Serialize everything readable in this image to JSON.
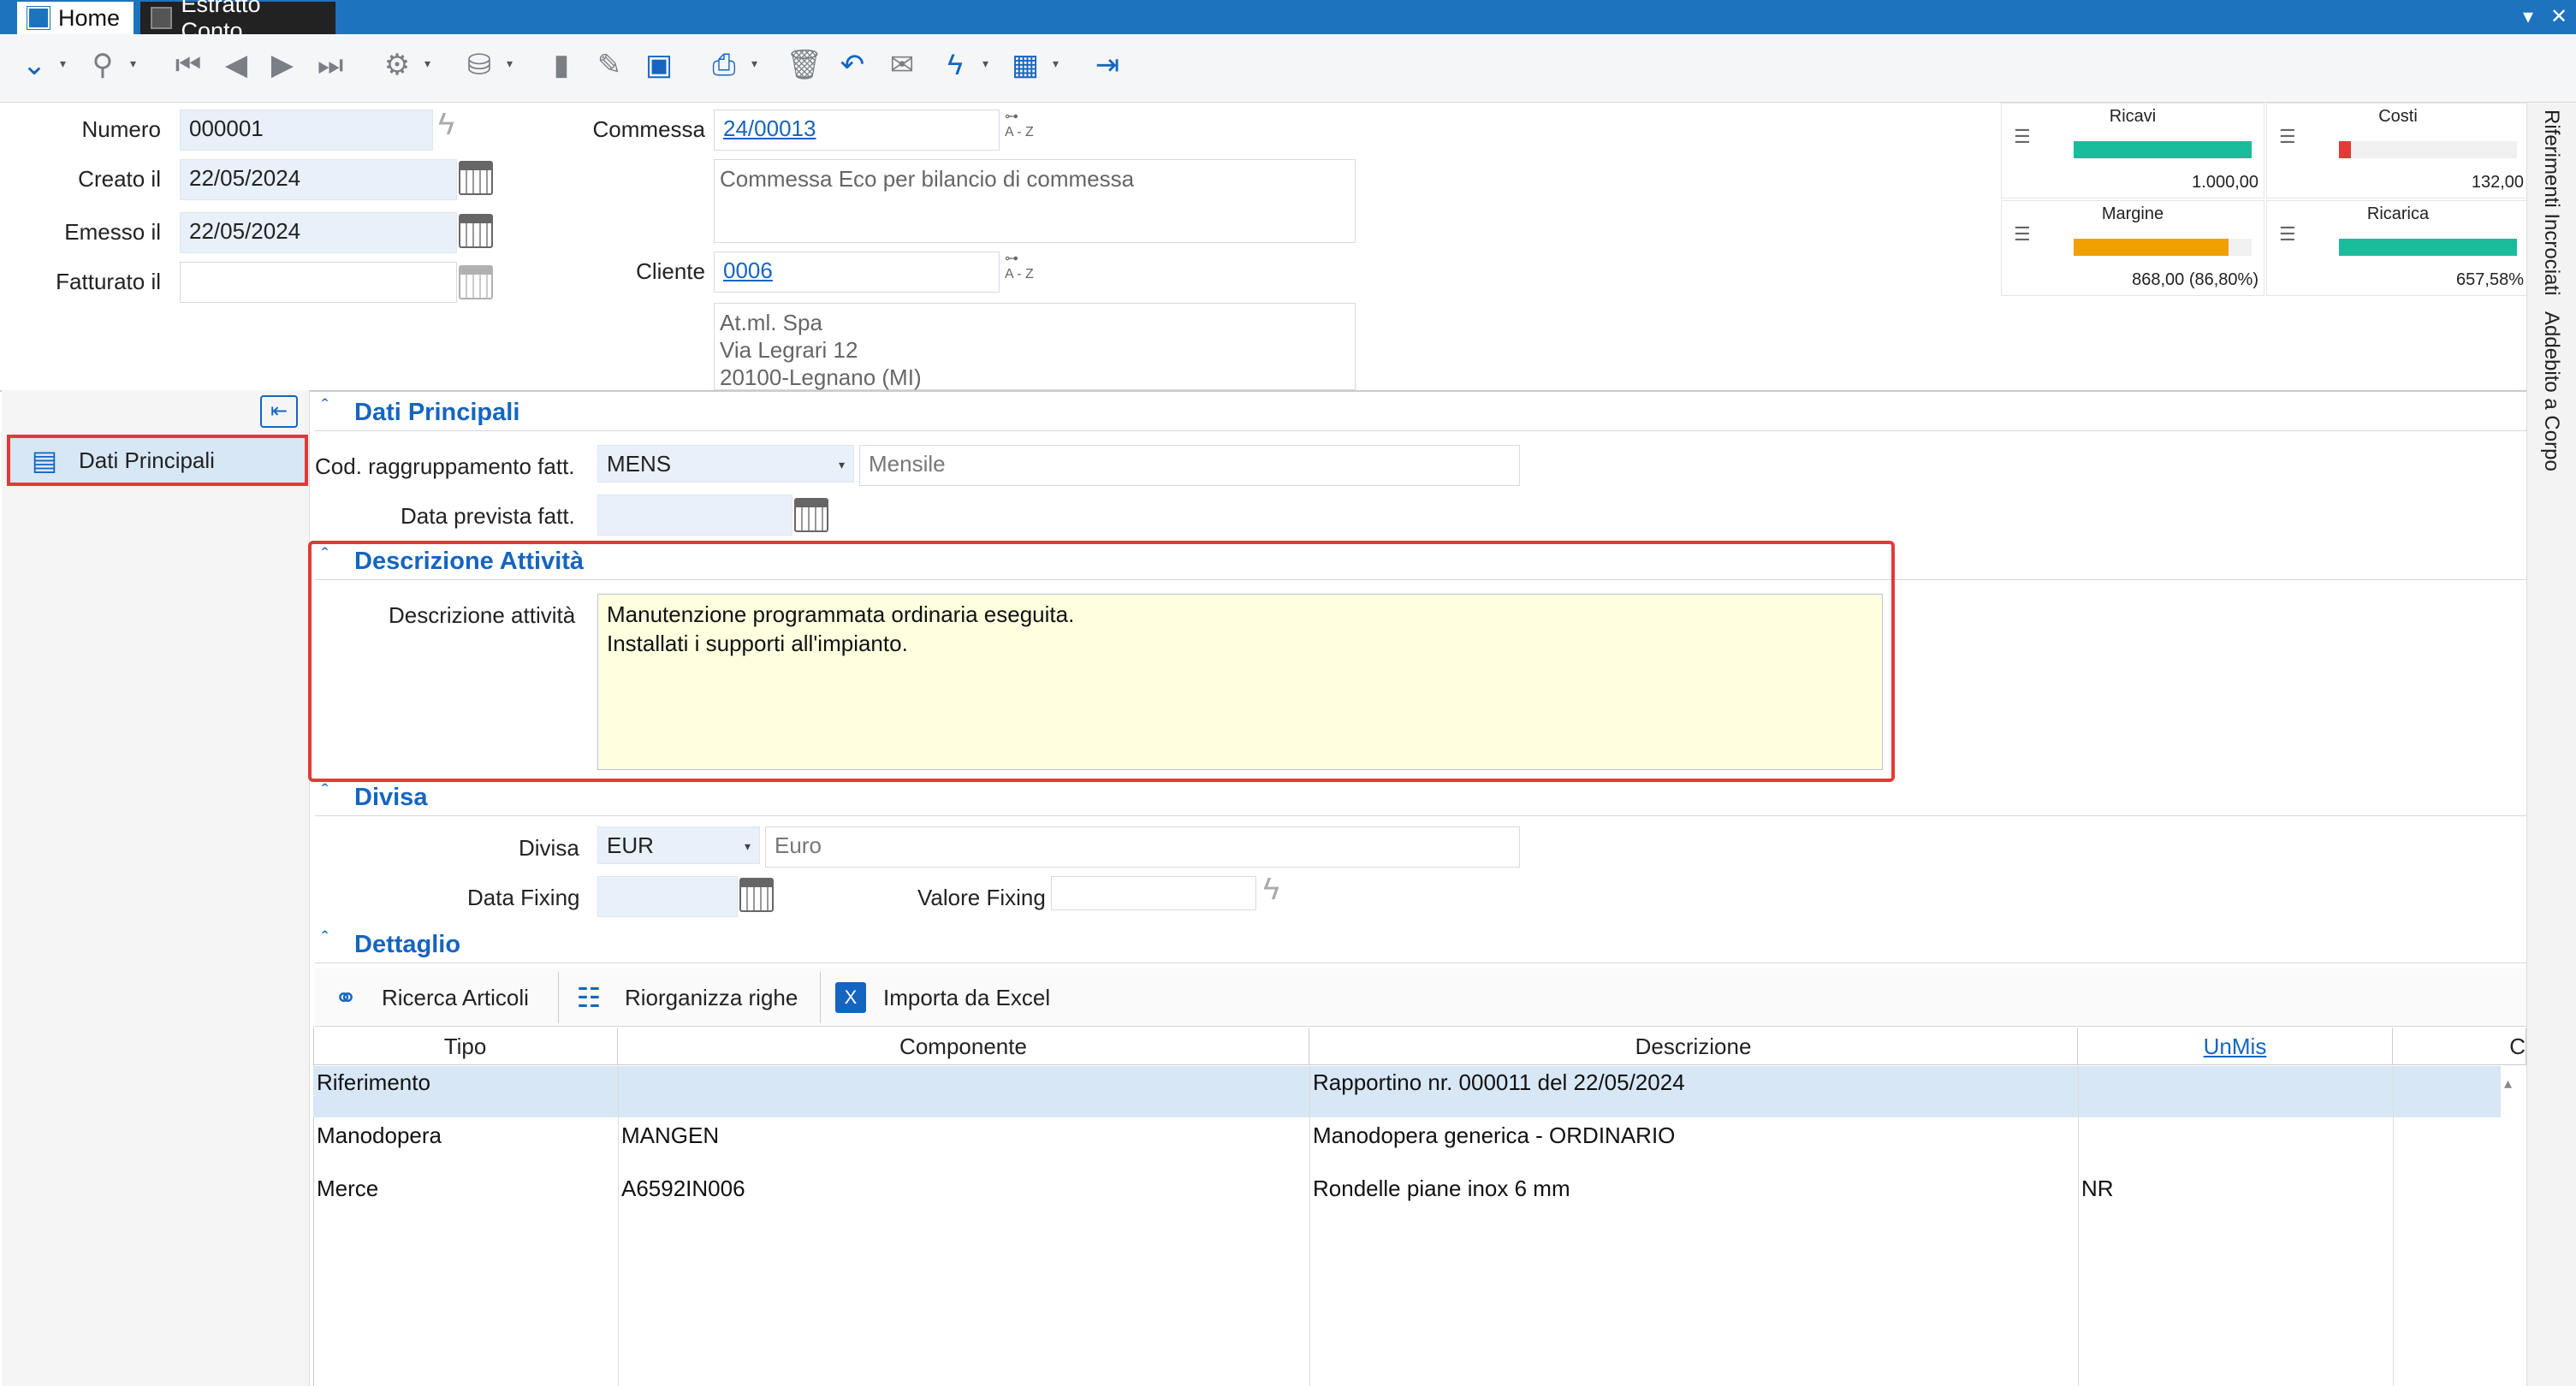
{
  "tabs": {
    "home": "Home",
    "estratto": "Estratto Conto"
  },
  "window_buttons": {
    "menu": "▾",
    "close": "✕"
  },
  "header": {
    "numero_label": "Numero",
    "numero_value": "000001",
    "creato_label": "Creato il",
    "creato_value": "22/05/2024",
    "emesso_label": "Emesso il",
    "emesso_value": "22/05/2024",
    "fatturato_label": "Fatturato il",
    "fatturato_value": "",
    "commessa_label": "Commessa",
    "commessa_value": "24/00013",
    "commessa_desc": "Commessa Eco per bilancio di commessa",
    "cliente_label": "Cliente",
    "cliente_value": "0006",
    "cliente_address": "At.ml. Spa\nVia Legrari 12\n20100-Legnano (MI)",
    "az_label": "A - Z"
  },
  "kpi": {
    "ricavi": {
      "title": "Ricavi",
      "value": "1.000,00",
      "fill": 1.0,
      "color": "#1abc9c"
    },
    "costi": {
      "title": "Costi",
      "value": "132,00",
      "fill": 0.13,
      "color": "#e53935"
    },
    "margine": {
      "title": "Margine",
      "value": "868,00 (86,80%)",
      "fill": 0.87,
      "color": "#f0a000"
    },
    "ricarica": {
      "title": "Ricarica",
      "value": "657,58%",
      "fill": 1.0,
      "color": "#1abc9c"
    }
  },
  "side_tabs": {
    "riferimenti": "Riferimenti Incrociati",
    "addebito": "Addebito a Corpo"
  },
  "nav": {
    "dati_principali": "Dati Principali"
  },
  "sections": {
    "dati_principali": "Dati Principali",
    "descrizione_attivita": "Descrizione Attività",
    "divisa": "Divisa",
    "dettaglio": "Dettaglio"
  },
  "dati": {
    "cod_label": "Cod. raggruppamento fatt.",
    "cod_value": "MENS",
    "cod_desc": "Mensile",
    "data_prev_label": "Data prevista fatt.",
    "data_prev_value": ""
  },
  "descrizione": {
    "label": "Descrizione attività",
    "text": "Manutenzione programmata ordinaria eseguita.\nInstallati i supporti all'impianto."
  },
  "divisa": {
    "label": "Divisa",
    "value": "EUR",
    "desc": "Euro",
    "fixing_label": "Data Fixing",
    "fixing_value": "",
    "valore_label": "Valore Fixing",
    "valore_value": ""
  },
  "dettaglio": {
    "buttons": {
      "ricerca": "Ricerca Articoli",
      "riorganizza": "Riorganizza righe",
      "importa": "Importa da Excel"
    },
    "columns": [
      "Tipo",
      "Componente",
      "Descrizione",
      "UnMis",
      "C"
    ],
    "rows": [
      {
        "tipo": "Riferimento",
        "componente": "",
        "descrizione": "Rapportino  nr. 000011 del 22/05/2024",
        "unmis": ""
      },
      {
        "tipo": "Manodopera",
        "componente": "MANGEN",
        "descrizione": "Manodopera generica - ORDINARIO",
        "unmis": ""
      },
      {
        "tipo": "Merce",
        "componente": "A6592IN006",
        "descrizione": "Rondelle piane inox 6 mm",
        "unmis": "NR"
      }
    ]
  }
}
